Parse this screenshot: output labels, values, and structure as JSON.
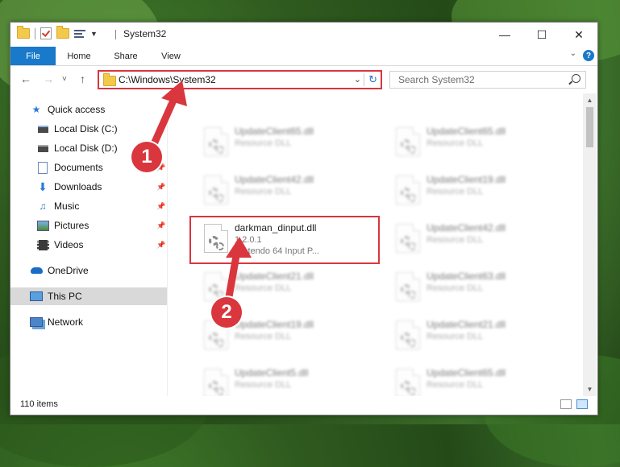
{
  "window": {
    "title": "System32",
    "minimize": "—",
    "maximize": "☐",
    "close": "✕"
  },
  "ribbon": {
    "tabs": [
      "File",
      "Home",
      "Share",
      "View"
    ],
    "help": "?"
  },
  "nav": {
    "back": "←",
    "forward": "→",
    "recent": "˅",
    "up": "↑",
    "address": "C:\\Windows\\System32",
    "refresh": "↻",
    "search_placeholder": "Search System32"
  },
  "sidebar": {
    "items": [
      {
        "label": "Quick access",
        "icon": "star-icon",
        "pinned": false
      },
      {
        "label": "Local Disk (C:)",
        "icon": "drive-icon",
        "pinned": false
      },
      {
        "label": "Local Disk (D:)",
        "icon": "drive-icon",
        "pinned": false
      },
      {
        "label": "Documents",
        "icon": "documents-icon",
        "pinned": true
      },
      {
        "label": "Downloads",
        "icon": "downloads-icon",
        "pinned": true
      },
      {
        "label": "Music",
        "icon": "music-icon",
        "pinned": true
      },
      {
        "label": "Pictures",
        "icon": "pictures-icon",
        "pinned": true
      },
      {
        "label": "Videos",
        "icon": "videos-icon",
        "pinned": true
      },
      {
        "label": "OneDrive",
        "icon": "onedrive-icon",
        "pinned": false
      },
      {
        "label": "This PC",
        "icon": "this-pc-icon",
        "pinned": false,
        "selected": true
      },
      {
        "label": "Network",
        "icon": "network-icon",
        "pinned": false
      }
    ]
  },
  "files": [
    {
      "name": "UpdateClient65.dll",
      "line1": "Resource DLL",
      "line2": "",
      "blurred": true
    },
    {
      "name": "UpdateClient65.dll",
      "line1": "Resource DLL",
      "line2": "",
      "blurred": true
    },
    {
      "name": "UpdateClient42.dll",
      "line1": "Resource DLL",
      "line2": "",
      "blurred": true
    },
    {
      "name": "UpdateClient19.dll",
      "line1": "Resource DLL",
      "line2": "",
      "blurred": true
    },
    {
      "name": "darkman_dinput.dll",
      "line1": "1.2.0.1",
      "line2": "Nintendo 64 Input P...",
      "blurred": false
    },
    {
      "name": "UpdateClient42.dll",
      "line1": "Resource DLL",
      "line2": "",
      "blurred": true
    },
    {
      "name": "UpdateClient21.dll",
      "line1": "Resource DLL",
      "line2": "",
      "blurred": true
    },
    {
      "name": "UpdateClient63.dll",
      "line1": "Resource DLL",
      "line2": "",
      "blurred": true
    },
    {
      "name": "UpdateClient19.dll",
      "line1": "Resource DLL",
      "line2": "",
      "blurred": true
    },
    {
      "name": "UpdateClient21.dll",
      "line1": "Resource DLL",
      "line2": "",
      "blurred": true
    },
    {
      "name": "UpdateClient5.dll",
      "line1": "Resource DLL",
      "line2": "",
      "blurred": true
    },
    {
      "name": "UpdateClient65.dll",
      "line1": "Resource DLL",
      "line2": "",
      "blurred": true
    }
  ],
  "status": {
    "item_count": "110 items"
  },
  "annotations": {
    "badge1": "1",
    "badge2": "2",
    "color": "#d9363e"
  }
}
